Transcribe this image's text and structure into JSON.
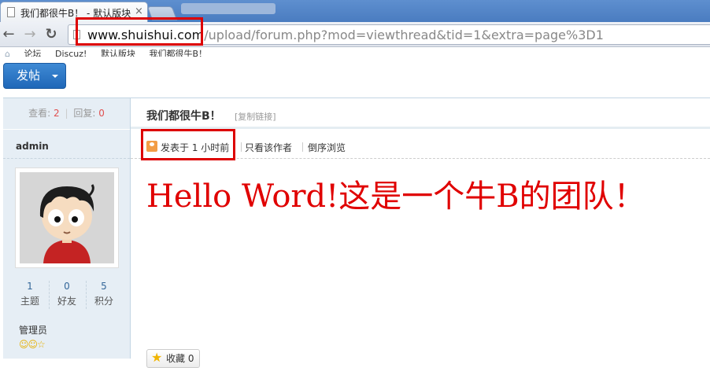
{
  "browser": {
    "tab_title": "我们都很牛B！ - 默认版块",
    "tab_close": "×",
    "url_host": "www.shuishui.com",
    "url_path": "/upload/forum.php?mod=viewthread&tid=1&extra=page%3D1",
    "back_icon": "←",
    "forward_icon": "→",
    "reload_icon": "↻"
  },
  "breadcrumb": [
    "论坛",
    "Discuz!",
    "默认版块",
    "我们都很牛B！"
  ],
  "post_button_label": "发帖",
  "stats": {
    "views_label": "查看:",
    "views": "2",
    "replies_label": "回复:",
    "replies": "0"
  },
  "author": {
    "name": "admin",
    "profile": [
      {
        "value": "1",
        "label": "主题"
      },
      {
        "value": "0",
        "label": "好友"
      },
      {
        "value": "5",
        "label": "积分"
      }
    ],
    "group": "管理员",
    "badges": "☺☺☆"
  },
  "thread": {
    "title": "我们都很牛B！",
    "copy_link": "[复制链接]",
    "post_time": "发表于 1 小时前",
    "author_only": "只看该作者",
    "reverse": "倒序浏览",
    "message": "Hello Word!这是一个牛B的团队！"
  },
  "favorite_label": "收藏 0",
  "colors": {
    "highlight_box": "#dd0000",
    "message_text": "#e00000",
    "post_button": "#2a75c6"
  }
}
